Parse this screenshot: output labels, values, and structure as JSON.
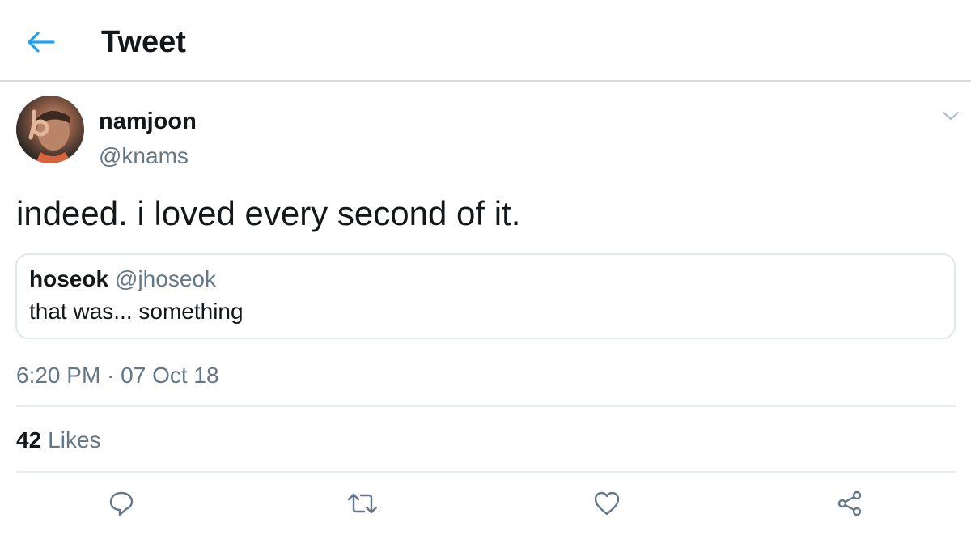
{
  "header": {
    "title": "Tweet",
    "back_icon": "arrow-left-icon",
    "accent": "#1da1f2"
  },
  "tweet": {
    "author_name": "namjoon",
    "author_handle": "@knams",
    "text": "indeed. i loved every second of it.",
    "timestamp": "6:20 PM · 07 Oct 18",
    "likes_count": "42",
    "likes_label": "Likes"
  },
  "quote": {
    "author_name": "hoseok",
    "author_handle": "@jhoseok",
    "text": "that was... something"
  },
  "actions": {
    "reply_icon": "reply-icon",
    "retweet_icon": "retweet-icon",
    "like_icon": "heart-icon",
    "share_icon": "share-icon",
    "icon_color": "#657786"
  }
}
